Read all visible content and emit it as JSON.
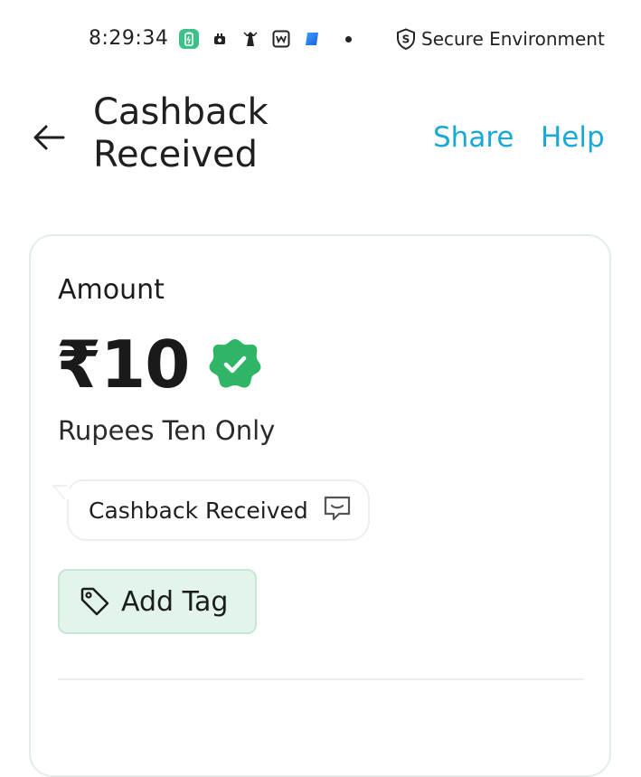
{
  "status_bar": {
    "time": "8:29:34",
    "icons": [
      "battery-saver-icon",
      "notification-icon",
      "app-icon",
      "wallet-icon",
      "blue-app-icon",
      "more-dot-icon"
    ],
    "secure_label": "Secure Environment"
  },
  "header": {
    "title": "Cashback Received",
    "share_label": "Share",
    "help_label": "Help"
  },
  "card": {
    "amount_label": "Amount",
    "amount_value": "₹10",
    "amount_words": "Rupees Ten Only",
    "note_text": "Cashback Received",
    "add_tag_label": "Add Tag"
  },
  "colors": {
    "accent": "#1aa8d6",
    "success": "#2fb566",
    "tag_bg": "#e3f5ea",
    "tag_border": "#c7e6d3"
  }
}
